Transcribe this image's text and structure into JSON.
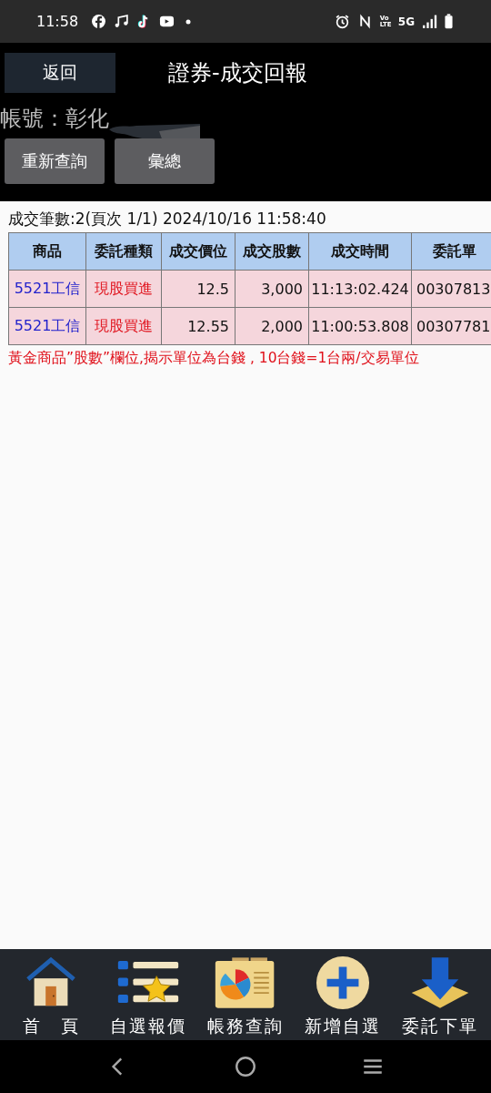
{
  "status_bar": {
    "time": "11:58",
    "volte": "Vo LTE",
    "network": "5G"
  },
  "header": {
    "back_button": "返回",
    "title": "證券-成交回報"
  },
  "account": {
    "label": "帳號：彰化"
  },
  "buttons": [
    "重新查詢",
    "彙總"
  ],
  "summary": "成交筆數:2(頁次 1/1) 2024/10/16 11:58:40",
  "table": {
    "columns": [
      "商品",
      "委託種類",
      "成交價位",
      "成交股數",
      "成交時間",
      "委託單"
    ],
    "rows": [
      [
        "5521工信",
        "現股買進",
        "12.5",
        "3,000",
        "11:13:02.424",
        "00307813"
      ],
      [
        "5521工信",
        "現股買進",
        "12.55",
        "2,000",
        "11:00:53.808",
        "00307781"
      ]
    ]
  },
  "note": "黃金商品”股數”欄位,揭示單位為台錢 , 10台錢=1台兩/交易單位",
  "bottom_nav": [
    {
      "kind": "home",
      "label": "首　頁"
    },
    {
      "kind": "watchlist",
      "label": "自選報價"
    },
    {
      "kind": "account",
      "label": "帳務查詢"
    },
    {
      "kind": "add",
      "label": "新增自選"
    },
    {
      "kind": "order",
      "label": "委託下單"
    }
  ]
}
